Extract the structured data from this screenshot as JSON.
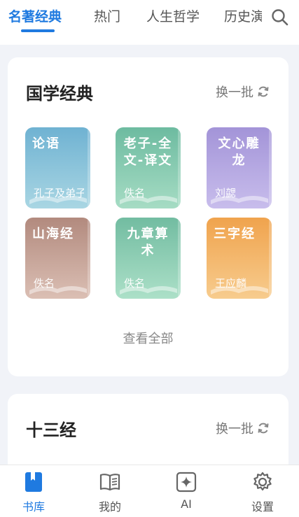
{
  "top_tabs": [
    {
      "label": "名著经典",
      "active": true
    },
    {
      "label": "热门",
      "active": false
    },
    {
      "label": "人生哲学",
      "active": false
    },
    {
      "label": "历史演",
      "active": false
    }
  ],
  "colors": {
    "accent": "#1f7ae0",
    "background": "#f1f3f8"
  },
  "section1": {
    "title": "国学经典",
    "refresh_label": "换一批",
    "view_all": "查看全部",
    "books": [
      {
        "title": "论语",
        "author": "孔子及弟子",
        "color_top": "#6fb2d2",
        "color_bottom": "#a9d6e3"
      },
      {
        "title": "老子-全文-译文",
        "author": "佚名",
        "color_top": "#6dbba0",
        "color_bottom": "#a6dcc4"
      },
      {
        "title": "文心雕龙",
        "author": "刘勰",
        "color_top": "#a394d8",
        "color_bottom": "#c8bdec"
      },
      {
        "title": "山海经",
        "author": "佚名",
        "color_top": "#b28a7e",
        "color_bottom": "#dbbfb4"
      },
      {
        "title": "九章算术",
        "author": "佚名",
        "color_top": "#72bca1",
        "color_bottom": "#ace0c8"
      },
      {
        "title": "三字经",
        "author": "王应麟",
        "color_top": "#f0a34d",
        "color_bottom": "#f7cc8e"
      }
    ]
  },
  "section2": {
    "title": "十三经",
    "refresh_label": "换一批"
  },
  "bottom_nav": [
    {
      "label": "书库",
      "icon": "bookmark-book-icon",
      "active": true
    },
    {
      "label": "我的",
      "icon": "open-book-icon",
      "active": false
    },
    {
      "label": "AI",
      "icon": "sparkle-icon",
      "active": false
    },
    {
      "label": "设置",
      "icon": "gear-icon",
      "active": false
    }
  ]
}
